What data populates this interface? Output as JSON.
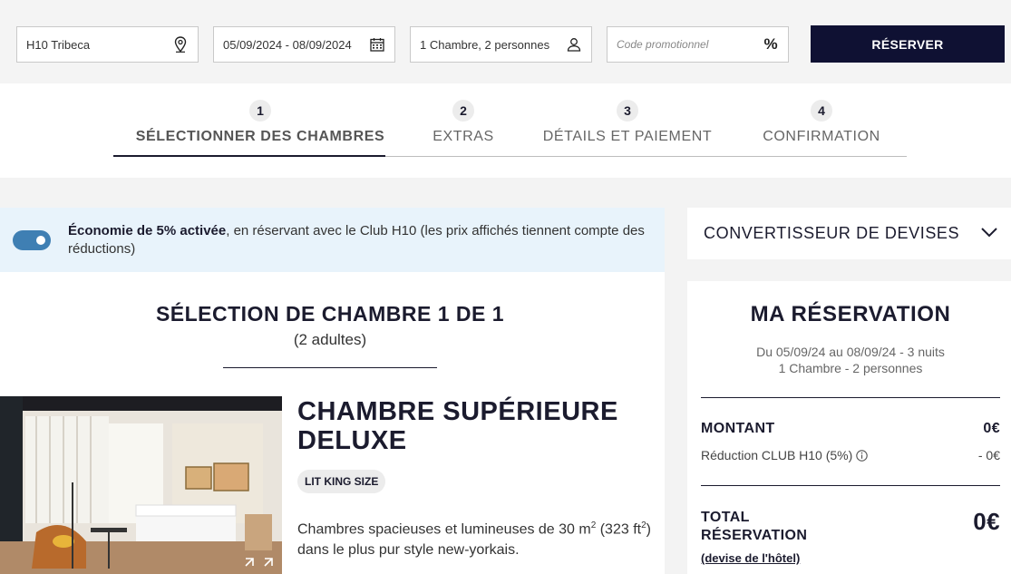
{
  "search": {
    "hotel": "H10 Tribeca",
    "dates": "05/09/2024 - 08/09/2024",
    "guests": "1 Chambre, 2 personnes",
    "promo_placeholder": "Code promotionnel",
    "promo_symbol": "%",
    "reserve_label": "RÉSERVER"
  },
  "steps": [
    {
      "num": "1",
      "label": "SÉLECTIONNER DES CHAMBRES"
    },
    {
      "num": "2",
      "label": "EXTRAS"
    },
    {
      "num": "3",
      "label": "DÉTAILS ET PAIEMENT"
    },
    {
      "num": "4",
      "label": "CONFIRMATION"
    }
  ],
  "club": {
    "bold": "Économie de 5% activée",
    "text": ", en réservant avec le Club H10 (les prix affichés tiennent compte des réductions)"
  },
  "selection": {
    "title": "SÉLECTION DE CHAMBRE 1 DE 1",
    "subtitle": "(2 adultes)"
  },
  "room": {
    "name": "CHAMBRE SUPÉRIEURE DELUXE",
    "bed": "LIT KING SIZE",
    "desc_a": "Chambres spacieuses et lumineuses de 30 m",
    "desc_b": "2",
    "desc_c": " (323 ft",
    "desc_d": "2",
    "desc_e": ") dans le plus pur style new-yorkais."
  },
  "converter": {
    "label": "CONVERTISSEUR DE DEVISES"
  },
  "booking": {
    "title": "MA RÉSERVATION",
    "dates": "Du 05/09/24 au 08/09/24 - 3 nuits",
    "rooms": "1 Chambre - 2 personnes",
    "montant_label": "MONTANT",
    "montant_value": "0€",
    "reduction_label": "Réduction CLUB H10 (5%)",
    "reduction_value": "- 0€",
    "total_label_1": "TOTAL",
    "total_label_2": "RÉSERVATION",
    "total_value": "0€",
    "currency_link": "(devise de l'hôtel)"
  },
  "colors": {
    "brand": "#0f1133",
    "club_bg": "#e8f3fb",
    "toggle": "#3f7fb3"
  },
  "icons": [
    "location-pin-icon",
    "calendar-icon",
    "person-icon",
    "percent-icon",
    "chevron-down-icon",
    "info-icon",
    "expand-icon"
  ]
}
